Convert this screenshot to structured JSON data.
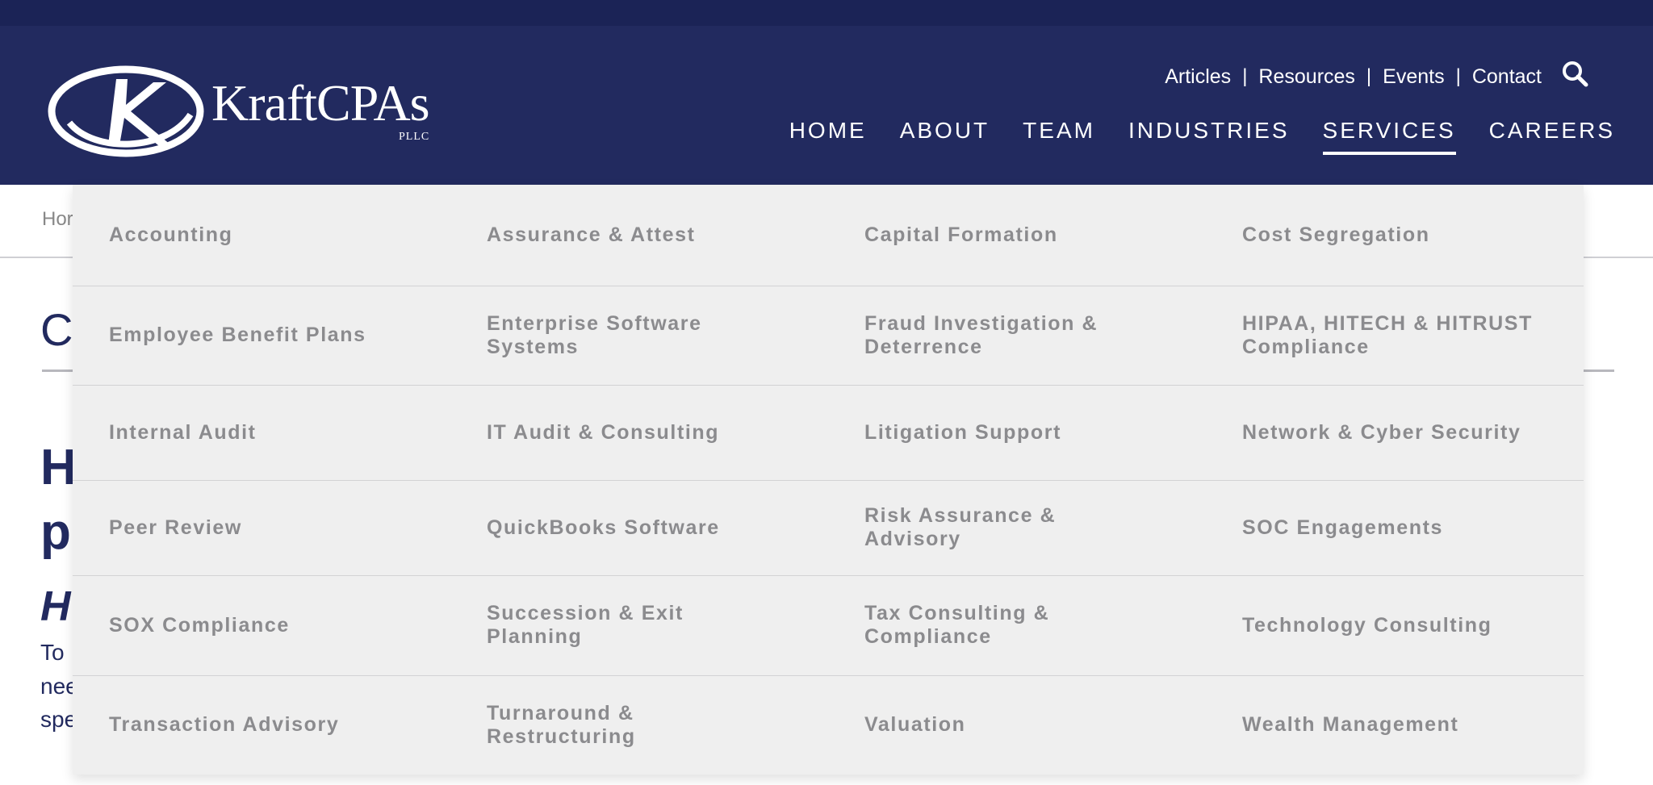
{
  "brand": {
    "name": "KraftCPAs",
    "suffix": "PLLC"
  },
  "utility_nav": [
    "Articles",
    "Resources",
    "Events",
    "Contact"
  ],
  "main_nav": [
    {
      "label": "HOME",
      "active": false
    },
    {
      "label": "ABOUT",
      "active": false
    },
    {
      "label": "TEAM",
      "active": false
    },
    {
      "label": "INDUSTRIES",
      "active": false
    },
    {
      "label": "SERVICES",
      "active": true
    },
    {
      "label": "CAREERS",
      "active": false
    }
  ],
  "background": {
    "breadcrumb_fragment": "Hor",
    "title_fragment": "C",
    "heading_fragments": [
      "H",
      "p"
    ],
    "italic_fragment": "H",
    "body_fragments": [
      "To",
      "nee",
      "spe"
    ]
  },
  "services_menu": [
    [
      "Accounting",
      "Assurance & Attest",
      "Capital Formation",
      "Cost Segregation"
    ],
    [
      "Employee Benefit Plans",
      "Enterprise Software Systems",
      "Fraud Investigation & Deterrence",
      "HIPAA, HITECH & HITRUST Compliance"
    ],
    [
      "Internal Audit",
      "IT Audit & Consulting",
      "Litigation Support",
      "Network & Cyber Security"
    ],
    [
      "Peer Review",
      "QuickBooks Software",
      "Risk Assurance & Advisory",
      "SOC Engagements"
    ],
    [
      "SOX Compliance",
      "Succession & Exit Planning",
      "Tax Consulting & Compliance",
      "Technology Consulting"
    ],
    [
      "Transaction Advisory",
      "Turnaround & Restructuring",
      "Valuation",
      "Wealth Management"
    ]
  ],
  "colors": {
    "header": "#222a5f",
    "top_strip": "#1b2356",
    "dropdown_bg": "#efefef",
    "menu_text": "#8b8b8e"
  }
}
